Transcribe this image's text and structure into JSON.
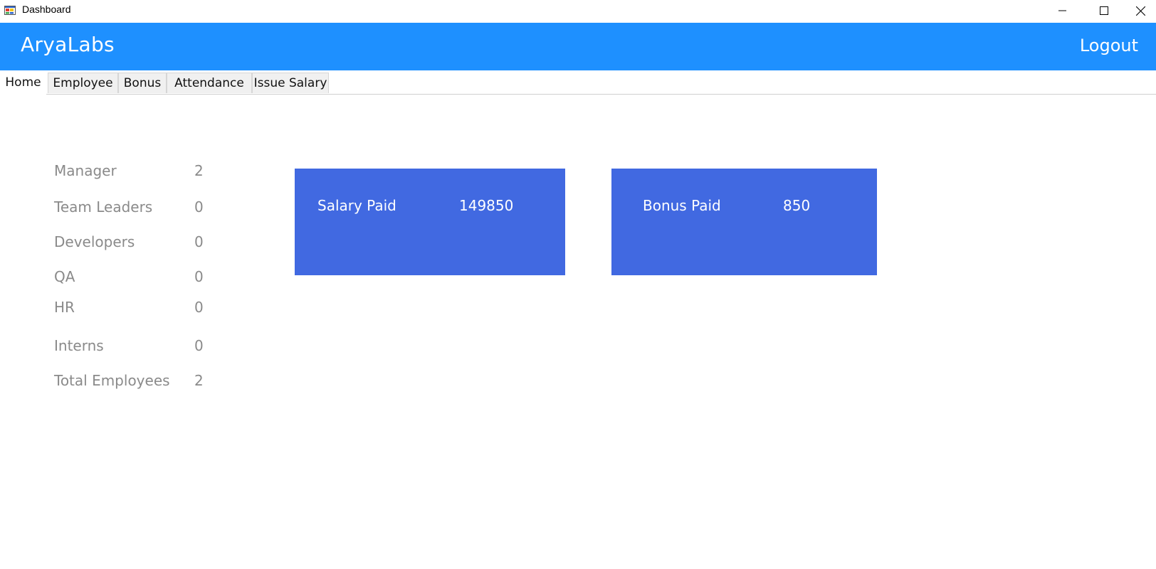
{
  "window": {
    "title": "Dashboard",
    "icon": "app-window-icon",
    "controls": [
      "minimize-icon",
      "maximize-icon",
      "close-icon"
    ]
  },
  "header": {
    "brand": "AryaLabs",
    "logout_label": "Logout",
    "background_color": "#1e90ff"
  },
  "tabs": [
    {
      "label": "Home",
      "active": true
    },
    {
      "label": "Employee",
      "active": false
    },
    {
      "label": "Bonus",
      "active": false
    },
    {
      "label": "Attendance",
      "active": false
    },
    {
      "label": "Issue Salary",
      "active": false
    }
  ],
  "stats": [
    {
      "label": "Manager",
      "value": "2"
    },
    {
      "label": "Team Leaders",
      "value": "0"
    },
    {
      "label": "Developers",
      "value": "0"
    },
    {
      "label": "QA",
      "value": "0"
    },
    {
      "label": "HR",
      "value": "0"
    },
    {
      "label": "Interns",
      "value": "0"
    },
    {
      "label": "Total Employees",
      "value": "2"
    }
  ],
  "cards": [
    {
      "label": "Salary Paid",
      "value": "149850"
    },
    {
      "label": "Bonus Paid",
      "value": "850"
    }
  ],
  "card_color": "#4169e1"
}
